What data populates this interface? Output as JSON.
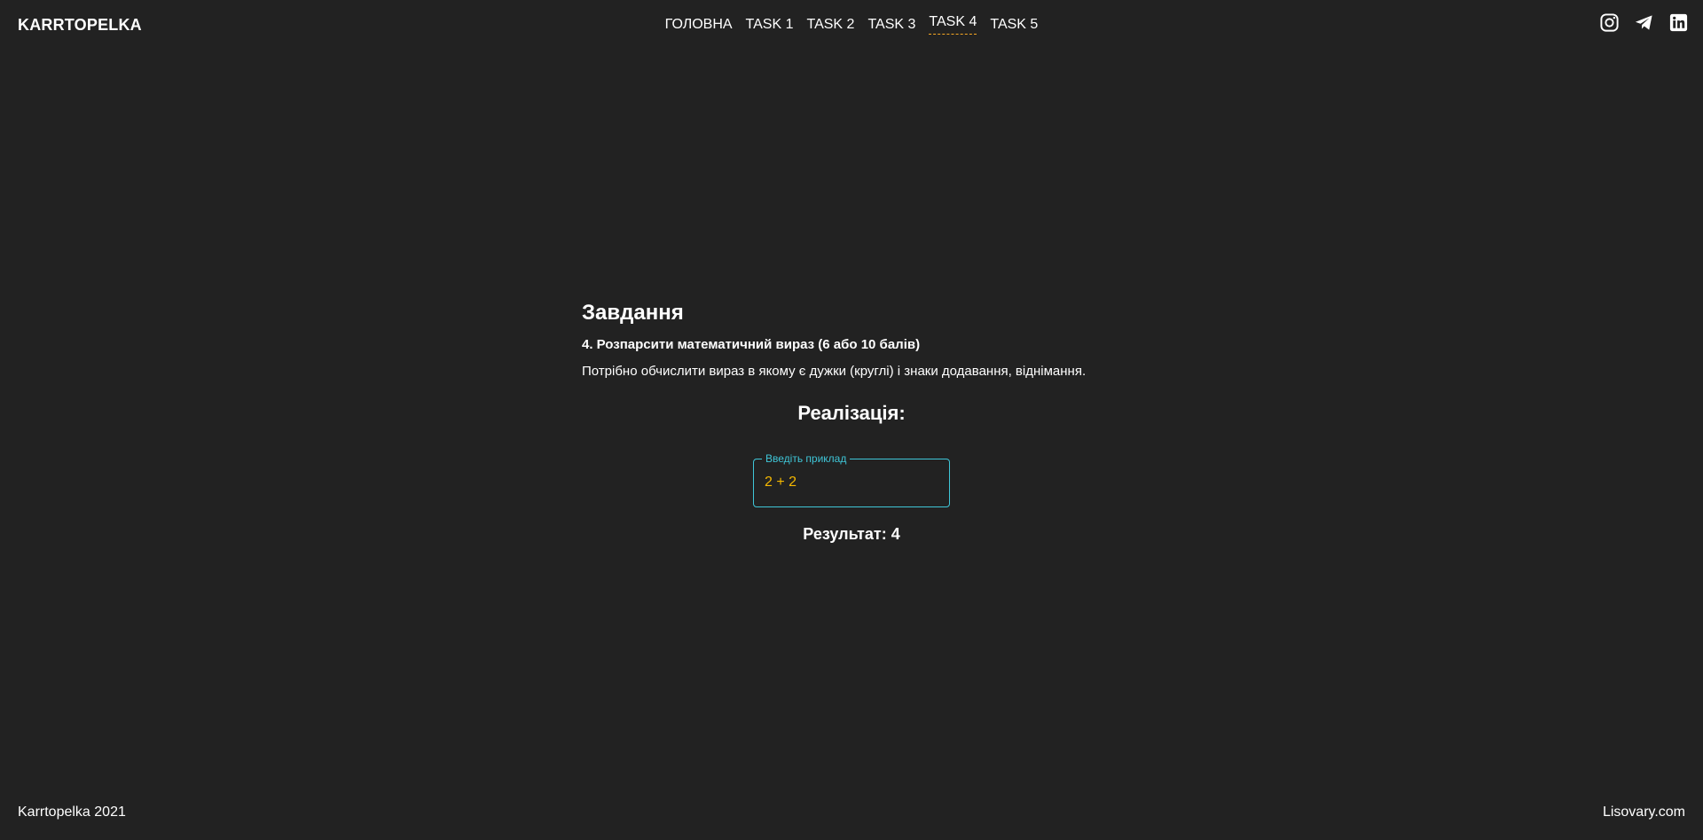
{
  "header": {
    "logo": "KARRTOPELKA",
    "nav": [
      {
        "label": "ГОЛОВНА",
        "active": false
      },
      {
        "label": "TASK 1",
        "active": false
      },
      {
        "label": "TASK 2",
        "active": false
      },
      {
        "label": "TASK 3",
        "active": false
      },
      {
        "label": "TASK 4",
        "active": true
      },
      {
        "label": "TASK 5",
        "active": false
      }
    ],
    "socials": [
      "instagram-icon",
      "telegram-icon",
      "linkedin-icon"
    ]
  },
  "main": {
    "heading": "Завдання",
    "task_title": "4. Розпарсити математичний вираз (6 або 10 балів)",
    "task_description": "Потрібно обчислити вираз в якому є дужки (круглі) і знаки додавання, віднімання.",
    "implementation_title": "Реалізація:",
    "input": {
      "label": "Введіть приклад",
      "value": "2 + 2"
    },
    "result": "Результат: 4"
  },
  "footer": {
    "copyright": "Karrtopelka 2021",
    "link": "Lisovary.com"
  },
  "colors": {
    "background": "#222222",
    "text": "#ffffff",
    "accent_cyan": "#3fc6d8",
    "accent_yellow": "#f5b800",
    "active_underline": "#f5a623"
  }
}
